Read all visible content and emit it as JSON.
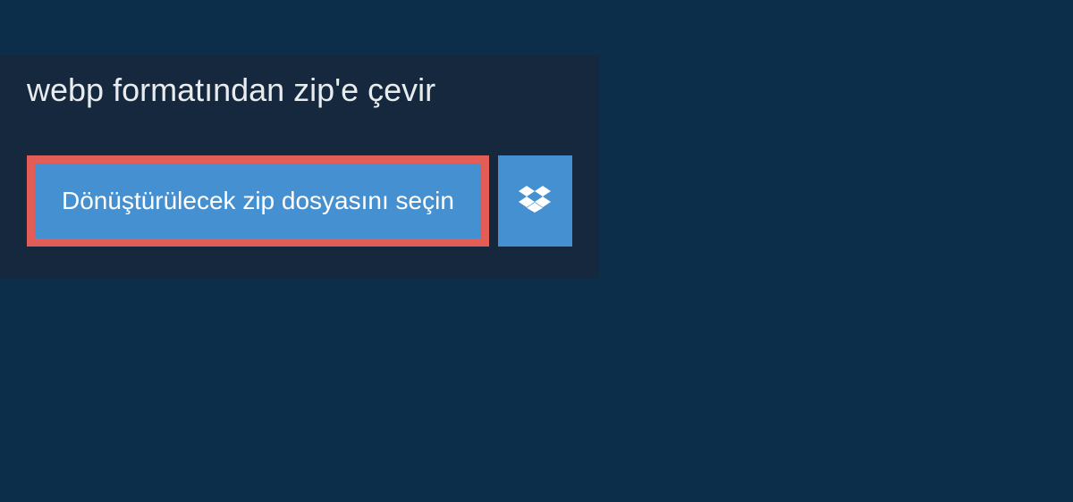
{
  "header": {
    "title": "webp formatından zip'e çevir"
  },
  "actions": {
    "select_file_label": "Dönüştürülecek zip dosyasını seçin"
  },
  "colors": {
    "page_bg": "#0d2e4a",
    "panel_bg": "#15283e",
    "button_bg": "#4590d1",
    "highlight_border": "#e25d55"
  }
}
